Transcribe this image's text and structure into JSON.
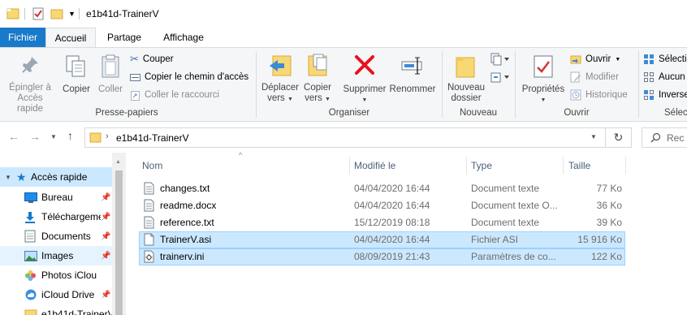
{
  "window": {
    "title": "e1b41d-TrainerV"
  },
  "tabs": {
    "file": "Fichier",
    "home": "Accueil",
    "share": "Partage",
    "view": "Affichage"
  },
  "ribbon": {
    "clipboard": {
      "label": "Presse-papiers",
      "pin": [
        "Épingler à",
        "Accès rapide"
      ],
      "copy": "Copier",
      "paste": "Coller",
      "cut": "Couper",
      "copy_path": "Copier le chemin d'accès",
      "paste_shortcut": "Coller le raccourci"
    },
    "organize": {
      "label": "Organiser",
      "move_to": [
        "Déplacer",
        "vers"
      ],
      "copy_to": [
        "Copier",
        "vers"
      ],
      "delete": "Supprimer",
      "rename": "Renommer"
    },
    "new": {
      "label": "Nouveau",
      "new_folder": [
        "Nouveau",
        "dossier"
      ]
    },
    "open": {
      "label": "Ouvrir",
      "properties": "Propriétés",
      "open": "Ouvrir",
      "edit": "Modifier",
      "history": "Historique"
    },
    "select": {
      "label": "Sélec",
      "select_all": "Sélecti",
      "select_none": "Aucun",
      "invert": "Inverse"
    }
  },
  "address": {
    "path": "e1b41d-TrainerV",
    "search_placeholder": "Rec"
  },
  "nav": {
    "items": [
      {
        "label": "Accès rapide",
        "icon": "star-icon"
      },
      {
        "label": "Bureau",
        "icon": "desktop-icon"
      },
      {
        "label": "Téléchargeme",
        "icon": "download-icon"
      },
      {
        "label": "Documents",
        "icon": "documents-icon"
      },
      {
        "label": "Images",
        "icon": "images-icon"
      },
      {
        "label": "Photos iClou",
        "icon": "photos-icon"
      },
      {
        "label": "iCloud Drive",
        "icon": "cloud-icon"
      },
      {
        "label": "e1b41d-TrainerV",
        "icon": "folder-icon"
      }
    ]
  },
  "columns": {
    "name": "Nom",
    "modified": "Modifié le",
    "type": "Type",
    "size": "Taille"
  },
  "files": [
    {
      "name": "changes.txt",
      "modified": "04/04/2020 16:44",
      "type": "Document texte",
      "size": "77 Ko",
      "icon": "text-file-icon"
    },
    {
      "name": "readme.docx",
      "modified": "04/04/2020 16:44",
      "type": "Document texte O...",
      "size": "36 Ko",
      "icon": "text-file-icon"
    },
    {
      "name": "reference.txt",
      "modified": "15/12/2019 08:18",
      "type": "Document texte",
      "size": "39 Ko",
      "icon": "text-file-icon"
    },
    {
      "name": "TrainerV.asi",
      "modified": "04/04/2020 16:44",
      "type": "Fichier ASI",
      "size": "15 916 Ko",
      "icon": "file-icon"
    },
    {
      "name": "trainerv.ini",
      "modified": "08/09/2019 21:43",
      "type": "Paramètres de co...",
      "size": "122 Ko",
      "icon": "settings-file-icon"
    }
  ],
  "colors": {
    "accent": "#1979ca",
    "selection": "#cce8ff",
    "selection_border": "#99d1ff",
    "delete_red": "#e81123"
  }
}
